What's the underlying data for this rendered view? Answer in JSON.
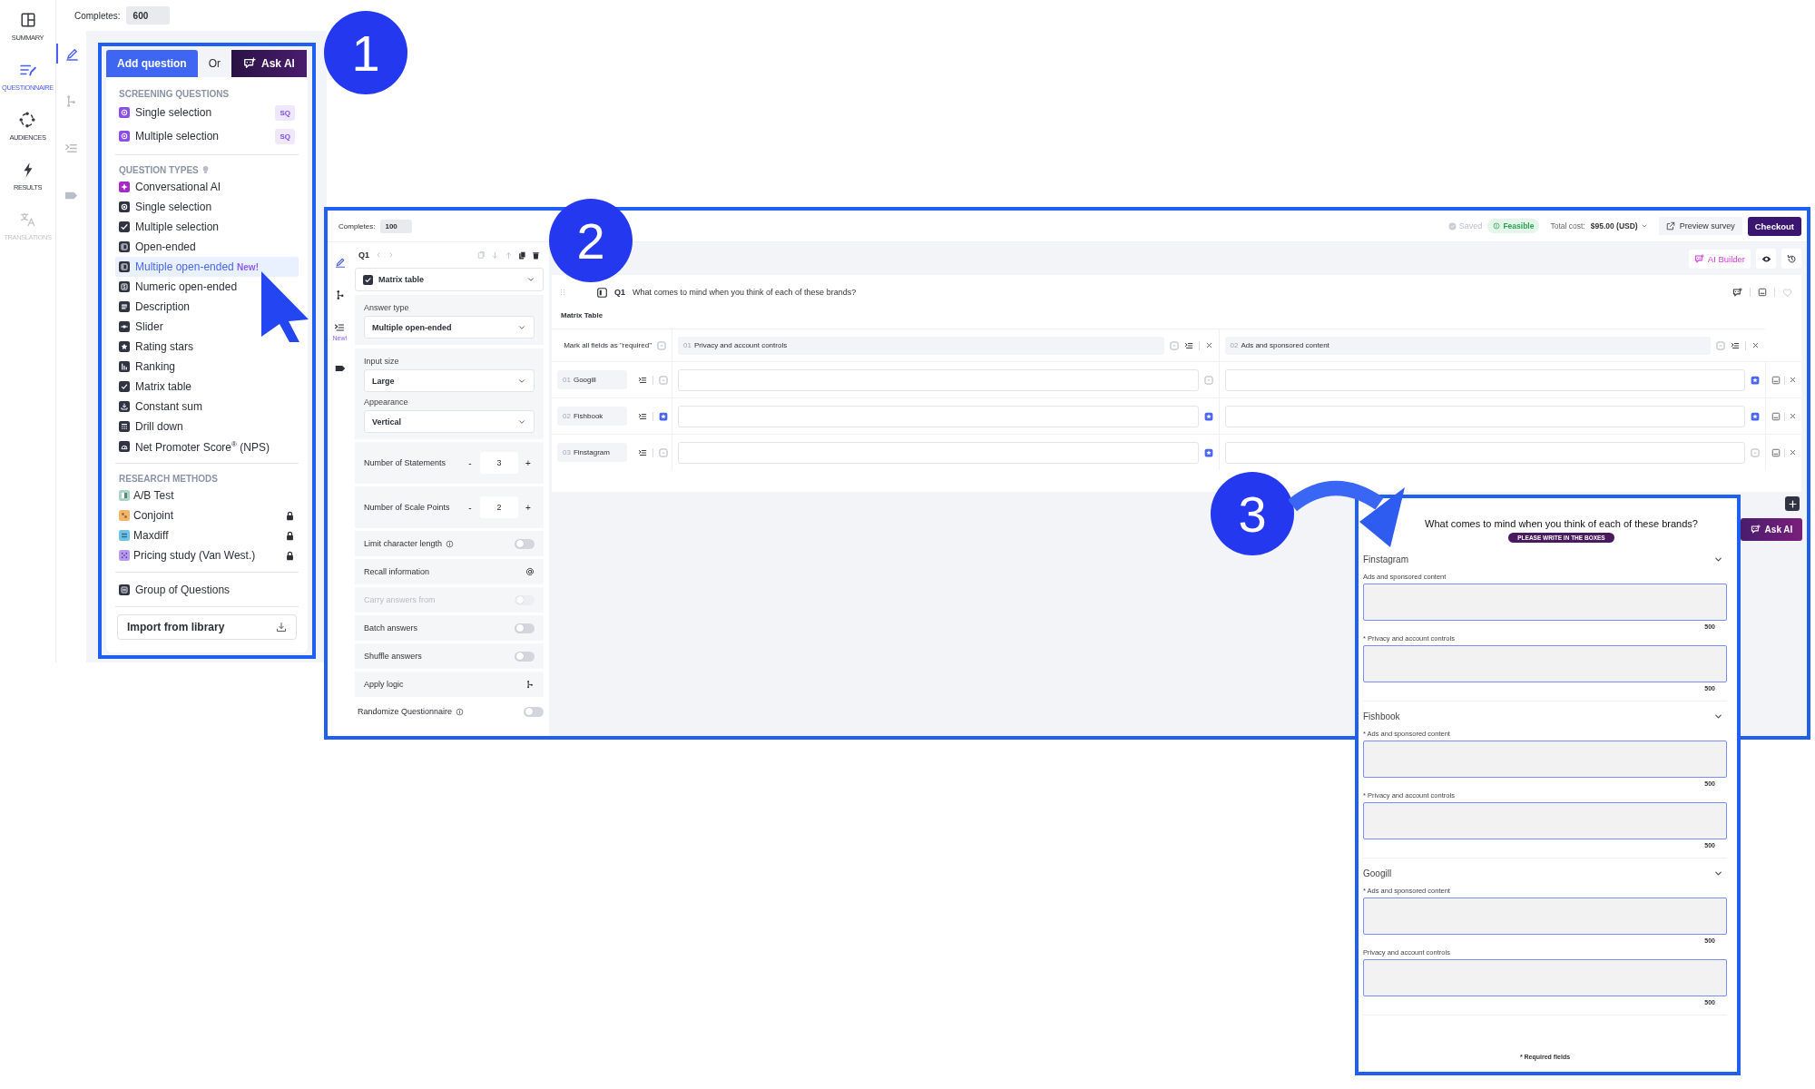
{
  "nav_rail": {
    "items": [
      {
        "label": "SUMMARY",
        "kind": "summary",
        "selected": false,
        "disabled": false
      },
      {
        "label": "QUESTIONNAIRE",
        "kind": "questionnaire",
        "selected": true,
        "disabled": false
      },
      {
        "label": "AUDIENCES",
        "kind": "audiences",
        "selected": false,
        "disabled": false
      },
      {
        "label": "RESULTS",
        "kind": "results",
        "selected": false,
        "disabled": false
      },
      {
        "label": "TRANSLATIONS",
        "kind": "translations",
        "selected": false,
        "disabled": true
      }
    ]
  },
  "builder": {
    "completes_label": "Completes:",
    "completes_value": "600",
    "tool_rail": [
      {
        "kind": "edit",
        "selected": true
      },
      {
        "kind": "logic",
        "selected": false
      },
      {
        "kind": "indent",
        "selected": false
      },
      {
        "kind": "tag",
        "selected": false
      }
    ],
    "add_question": "Add question",
    "or": "Or",
    "ask_ai": "Ask AI",
    "screening": {
      "title": "SCREENING QUESTIONS",
      "items": [
        {
          "label": "Single selection",
          "badge": "SQ"
        },
        {
          "label": "Multiple selection",
          "badge": "SQ"
        }
      ]
    },
    "question_types": {
      "title": "QUESTION TYPES",
      "hint": true,
      "items": [
        {
          "label": "Conversational AI",
          "kind": "conversational",
          "selected": false
        },
        {
          "label": "Single selection",
          "kind": "single",
          "selected": false
        },
        {
          "label": "Multiple selection",
          "kind": "multiple",
          "selected": false
        },
        {
          "label": "Open-ended",
          "kind": "open",
          "selected": false
        },
        {
          "label": "Multiple open-ended",
          "kind": "open",
          "selected": true,
          "badge": "New!"
        },
        {
          "label": "Numeric open-ended",
          "kind": "numeric",
          "selected": false
        },
        {
          "label": "Description",
          "kind": "description",
          "selected": false
        },
        {
          "label": "Slider",
          "kind": "slider",
          "selected": false
        },
        {
          "label": "Rating stars",
          "kind": "rating",
          "selected": false
        },
        {
          "label": "Ranking",
          "kind": "ranking",
          "selected": false
        },
        {
          "label": "Matrix table",
          "kind": "matrix",
          "selected": false
        },
        {
          "label": "Constant sum",
          "kind": "constant",
          "selected": false
        },
        {
          "label": "Drill down",
          "kind": "drilldown",
          "selected": false
        },
        {
          "label": "Net Promoter Score$^{®}$ (NPS)",
          "kind": "nps",
          "selected": false
        }
      ]
    },
    "research_methods": {
      "title": "RESEARCH METHODS",
      "items": [
        {
          "label": "A/B Test",
          "kind": "ab",
          "color": "#a9d5c6",
          "locked": false
        },
        {
          "label": "Conjoint",
          "kind": "conjoint",
          "color": "#f4b46a",
          "locked": true
        },
        {
          "label": "Maxdiff",
          "kind": "maxdiff",
          "color": "#6fc3e8",
          "locked": true
        },
        {
          "label": "Pricing study (Van West.)",
          "kind": "pricing",
          "color": "#b89af0",
          "locked": true
        }
      ]
    },
    "group_item": "Group of Questions",
    "import_button": "Import from library"
  },
  "editor": {
    "completes_label": "Completes:",
    "completes_value": "100",
    "saved": "Saved",
    "feasible": "Feasible",
    "total_cost_label": "Total cost:",
    "total_cost": "$95.00 (USD)",
    "preview": "Preview survey",
    "checkout": "Checkout",
    "ai_builder": "AI Builder",
    "tool_rail": [
      {
        "kind": "edit",
        "selected": true
      },
      {
        "kind": "logic",
        "selected": false
      },
      {
        "kind": "indent",
        "selected": false,
        "badge": "New!"
      },
      {
        "kind": "tag",
        "selected": false
      }
    ],
    "question_number": "Q1",
    "question_type": "Matrix table",
    "dropdown_groups": [
      {
        "fields": [
          {
            "label": "Answer type",
            "value": "Multiple open-ended"
          }
        ]
      },
      {
        "fields": [
          {
            "label": "Input size",
            "value": "Large"
          },
          {
            "label": "Appearance",
            "value": "Vertical"
          }
        ]
      }
    ],
    "steppers": [
      {
        "label": "Number of Statements",
        "minus": "-",
        "value": "3",
        "plus": "+"
      },
      {
        "label": "Number of Scale Points",
        "minus": "-",
        "value": "2",
        "plus": "+"
      }
    ],
    "options": [
      {
        "label": "Limit character length",
        "kind": "toggle",
        "info": true,
        "on": false,
        "disabled": false
      },
      {
        "label": "Recall information",
        "kind": "recall"
      },
      {
        "label": "Carry answers from",
        "kind": "toggle",
        "info": false,
        "on": false,
        "disabled": true
      },
      {
        "label": "Batch answers",
        "kind": "toggle",
        "info": false,
        "on": false,
        "disabled": false
      },
      {
        "label": "Shuffle answers",
        "kind": "toggle",
        "info": false,
        "on": false,
        "disabled": false
      },
      {
        "label": "Apply logic",
        "kind": "logic"
      }
    ],
    "randomize": {
      "label": "Randomize Questionnaire",
      "info": true,
      "on": false
    },
    "question": {
      "number": "Q1",
      "text": "What comes to mind when you think of each of these brands?",
      "table_title": "Matrix Table",
      "mark_all": "Mark all fields as \"required\"",
      "mark_all_checked": false,
      "columns": [
        {
          "number": "01",
          "label": "Privacy and account controls",
          "required": false
        },
        {
          "number": "02",
          "label": "Ads and sponsored content",
          "required": false
        }
      ],
      "rows": [
        {
          "number": "01",
          "label": "Googill",
          "required": false,
          "cells": [
            {
              "required": false
            },
            {
              "required": true
            }
          ]
        },
        {
          "number": "02",
          "label": "Fishbook",
          "required": true,
          "cells": [
            {
              "required": true
            },
            {
              "required": true
            }
          ]
        },
        {
          "number": "03",
          "label": "Finstagram",
          "required": false,
          "cells": [
            {
              "required": true
            },
            {
              "required": false
            }
          ]
        }
      ]
    },
    "ask_ai": "Ask AI"
  },
  "preview": {
    "title": "What comes to mind when you think of each of these brands?",
    "instruction": "PLEASE WRITE IN THE BOXES",
    "groups": [
      {
        "name": "Finstagram",
        "expanded": true,
        "fields": [
          {
            "label": "Ads and sponsored content",
            "counter": "500"
          },
          {
            "label": "* Privacy and account controls",
            "counter": "500"
          }
        ]
      },
      {
        "name": "Fishbook",
        "expanded": true,
        "fields": [
          {
            "label": "* Ads and sponsored content",
            "counter": "500"
          },
          {
            "label": "* Privacy and account controls",
            "counter": "500"
          }
        ]
      },
      {
        "name": "Googill",
        "expanded": true,
        "fields": [
          {
            "label": "* Ads and sponsored content",
            "counter": "500"
          },
          {
            "label": "Privacy and account controls",
            "counter": "500"
          }
        ]
      }
    ],
    "footnote": "* Required fields"
  },
  "callouts": [
    {
      "number": "1"
    },
    {
      "number": "2"
    },
    {
      "number": "3"
    }
  ]
}
